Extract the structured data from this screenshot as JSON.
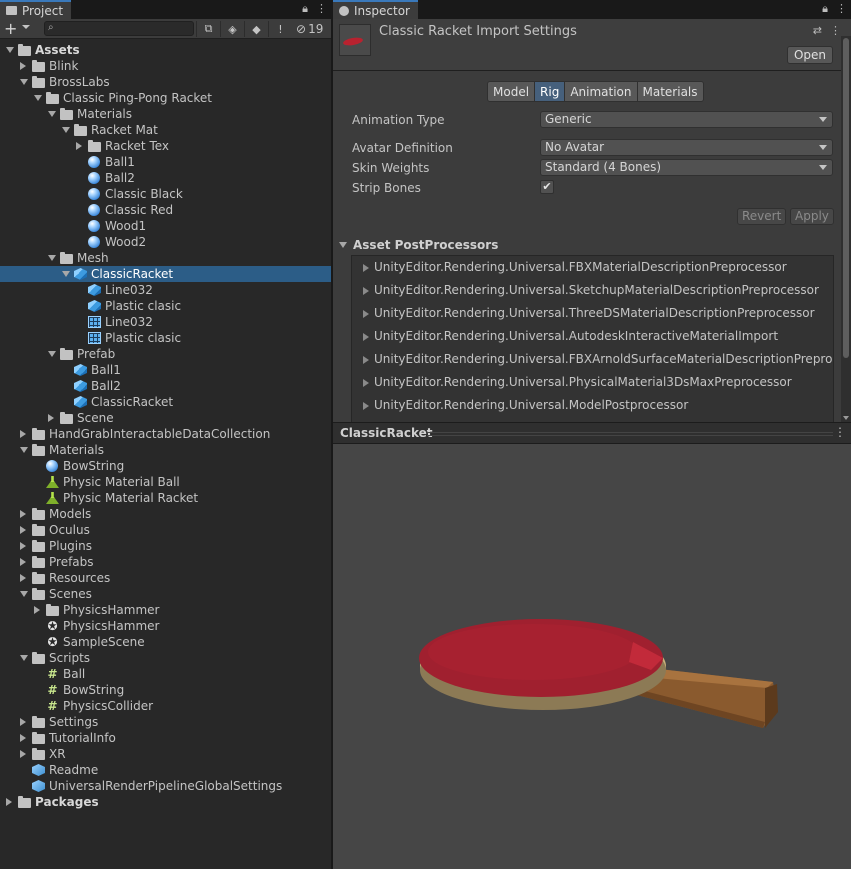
{
  "project": {
    "tab_label": "Project",
    "search_placeholder": "",
    "hidden_count": "19",
    "tree": [
      {
        "label": "Assets",
        "depth": 0,
        "arrow": "open",
        "icon": "folder",
        "bold": true
      },
      {
        "label": "Blink",
        "depth": 1,
        "arrow": "closed",
        "icon": "folder"
      },
      {
        "label": "BrossLabs",
        "depth": 1,
        "arrow": "open",
        "icon": "folder"
      },
      {
        "label": "Classic Ping-Pong Racket",
        "depth": 2,
        "arrow": "open",
        "icon": "folder"
      },
      {
        "label": "Materials",
        "depth": 3,
        "arrow": "open",
        "icon": "folder"
      },
      {
        "label": "Racket Mat",
        "depth": 4,
        "arrow": "open",
        "icon": "folder"
      },
      {
        "label": "Racket Tex",
        "depth": 5,
        "arrow": "closed",
        "icon": "folder"
      },
      {
        "label": "Ball1",
        "depth": 5,
        "arrow": "none",
        "icon": "material"
      },
      {
        "label": "Ball2",
        "depth": 5,
        "arrow": "none",
        "icon": "material"
      },
      {
        "label": "Classic Black",
        "depth": 5,
        "arrow": "none",
        "icon": "material"
      },
      {
        "label": "Classic Red",
        "depth": 5,
        "arrow": "none",
        "icon": "material"
      },
      {
        "label": "Wood1",
        "depth": 5,
        "arrow": "none",
        "icon": "material"
      },
      {
        "label": "Wood2",
        "depth": 5,
        "arrow": "none",
        "icon": "material"
      },
      {
        "label": "Mesh",
        "depth": 3,
        "arrow": "open",
        "icon": "folder"
      },
      {
        "label": "ClassicRacket",
        "depth": 4,
        "arrow": "open",
        "icon": "model",
        "selected": true
      },
      {
        "label": "Line032",
        "depth": 5,
        "arrow": "none",
        "icon": "model"
      },
      {
        "label": "Plastic clasic",
        "depth": 5,
        "arrow": "none",
        "icon": "model"
      },
      {
        "label": "Line032",
        "depth": 5,
        "arrow": "none",
        "icon": "mesh"
      },
      {
        "label": "Plastic clasic",
        "depth": 5,
        "arrow": "none",
        "icon": "mesh"
      },
      {
        "label": "Prefab",
        "depth": 3,
        "arrow": "open",
        "icon": "folder"
      },
      {
        "label": "Ball1",
        "depth": 4,
        "arrow": "none",
        "icon": "prefab"
      },
      {
        "label": "Ball2",
        "depth": 4,
        "arrow": "none",
        "icon": "prefab"
      },
      {
        "label": "ClassicRacket",
        "depth": 4,
        "arrow": "none",
        "icon": "prefab"
      },
      {
        "label": "Scene",
        "depth": 3,
        "arrow": "closed",
        "icon": "folder"
      },
      {
        "label": "HandGrabInteractableDataCollection",
        "depth": 1,
        "arrow": "closed",
        "icon": "folder"
      },
      {
        "label": "Materials",
        "depth": 1,
        "arrow": "open",
        "icon": "folder"
      },
      {
        "label": "BowString",
        "depth": 2,
        "arrow": "none",
        "icon": "material"
      },
      {
        "label": "Physic Material Ball",
        "depth": 2,
        "arrow": "none",
        "icon": "physic"
      },
      {
        "label": "Physic Material Racket",
        "depth": 2,
        "arrow": "none",
        "icon": "physic"
      },
      {
        "label": "Models",
        "depth": 1,
        "arrow": "closed",
        "icon": "folder"
      },
      {
        "label": "Oculus",
        "depth": 1,
        "arrow": "closed",
        "icon": "folder"
      },
      {
        "label": "Plugins",
        "depth": 1,
        "arrow": "closed",
        "icon": "folder"
      },
      {
        "label": "Prefabs",
        "depth": 1,
        "arrow": "closed",
        "icon": "folder"
      },
      {
        "label": "Resources",
        "depth": 1,
        "arrow": "closed",
        "icon": "folder"
      },
      {
        "label": "Scenes",
        "depth": 1,
        "arrow": "open",
        "icon": "folder"
      },
      {
        "label": "PhysicsHammer",
        "depth": 2,
        "arrow": "closed",
        "icon": "folder"
      },
      {
        "label": "PhysicsHammer",
        "depth": 2,
        "arrow": "none",
        "icon": "scene"
      },
      {
        "label": "SampleScene",
        "depth": 2,
        "arrow": "none",
        "icon": "scene"
      },
      {
        "label": "Scripts",
        "depth": 1,
        "arrow": "open",
        "icon": "folder"
      },
      {
        "label": "Ball",
        "depth": 2,
        "arrow": "none",
        "icon": "script"
      },
      {
        "label": "BowString",
        "depth": 2,
        "arrow": "none",
        "icon": "script"
      },
      {
        "label": "PhysicsCollider",
        "depth": 2,
        "arrow": "none",
        "icon": "script"
      },
      {
        "label": "Settings",
        "depth": 1,
        "arrow": "closed",
        "icon": "folder"
      },
      {
        "label": "TutorialInfo",
        "depth": 1,
        "arrow": "closed",
        "icon": "folder"
      },
      {
        "label": "XR",
        "depth": 1,
        "arrow": "closed",
        "icon": "folder"
      },
      {
        "label": "Readme",
        "depth": 1,
        "arrow": "none",
        "icon": "asset"
      },
      {
        "label": "UniversalRenderPipelineGlobalSettings",
        "depth": 1,
        "arrow": "none",
        "icon": "asset"
      },
      {
        "label": "Packages",
        "depth": 0,
        "arrow": "closed",
        "icon": "folder",
        "bold": true
      }
    ]
  },
  "inspector": {
    "tab_label": "Inspector",
    "title": "Classic Racket Import Settings",
    "open_label": "Open",
    "tabs": [
      {
        "label": "Model",
        "active": false
      },
      {
        "label": "Rig",
        "active": true
      },
      {
        "label": "Animation",
        "active": false
      },
      {
        "label": "Materials",
        "active": false
      }
    ],
    "animation_type": {
      "label": "Animation Type",
      "value": "Generic"
    },
    "avatar_definition": {
      "label": "Avatar Definition",
      "value": "No Avatar"
    },
    "skin_weights": {
      "label": "Skin Weights",
      "value": "Standard (4 Bones)"
    },
    "strip_bones": {
      "label": "Strip Bones",
      "checked": true,
      "check_glyph": "✔"
    },
    "revert_label": "Revert",
    "apply_label": "Apply",
    "postprocessors": {
      "title": "Asset PostProcessors",
      "items": [
        "UnityEditor.Rendering.Universal.FBXMaterialDescriptionPreprocessor",
        "UnityEditor.Rendering.Universal.SketchupMaterialDescriptionPreprocessor",
        "UnityEditor.Rendering.Universal.ThreeDSMaterialDescriptionPreprocessor",
        "UnityEditor.Rendering.Universal.AutodeskInteractiveMaterialImport",
        "UnityEditor.Rendering.Universal.FBXArnoldSurfaceMaterialDescriptionPreprocesso",
        "UnityEditor.Rendering.Universal.PhysicalMaterial3DsMaxPreprocessor",
        "UnityEditor.Rendering.Universal.ModelPostprocessor"
      ]
    }
  },
  "preview": {
    "title": "ClassicRacket",
    "colors": {
      "background": "#464646",
      "rubber": "#a0202f",
      "wood": "#8a5a2e"
    }
  }
}
